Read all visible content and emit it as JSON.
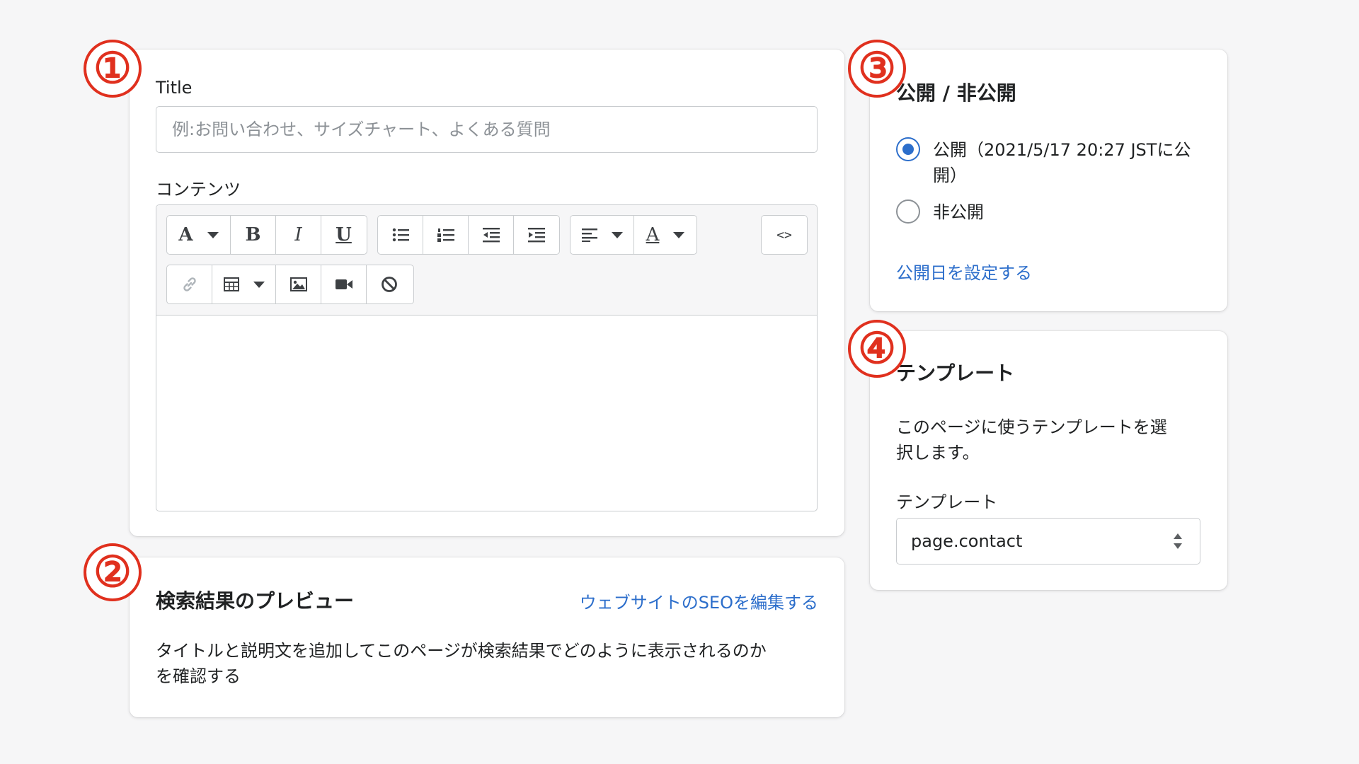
{
  "badges": [
    "①",
    "②",
    "③",
    "④"
  ],
  "page_form": {
    "title_label": "Title",
    "title_placeholder": "例:お問い合わせ、サイズチャート、よくある質問",
    "title_value": "",
    "content_label": "コンテンツ",
    "toolbar": {
      "font_button": "A",
      "bold_button": "B",
      "italic_button": "I",
      "underline_button": "U",
      "text_color_button": "A",
      "html_button": "<>"
    }
  },
  "seo_preview": {
    "title": "検索結果のプレビュー",
    "edit_link": "ウェブサイトのSEOを編集する",
    "description_line1": "タイトルと説明文を追加してこのページが検索結果でどのように表示されるのか",
    "description_line2": "を確認する"
  },
  "visibility": {
    "title": "公開 / 非公開",
    "option_public_line1": "公開（2021/5/17 20:27 JSTに公",
    "option_public_line2": "開）",
    "option_public_selected": true,
    "option_hidden": "非公開",
    "set_date_link": "公開日を設定する"
  },
  "template": {
    "title": "テンプレート",
    "description_line1": "このページに使うテンプレートを選",
    "description_line2": "択します。",
    "select_label": "テンプレート",
    "select_value": "page.contact"
  },
  "colors": {
    "accent": "#2c6ecb",
    "badge": "#e0301e",
    "background": "#f6f6f7"
  }
}
